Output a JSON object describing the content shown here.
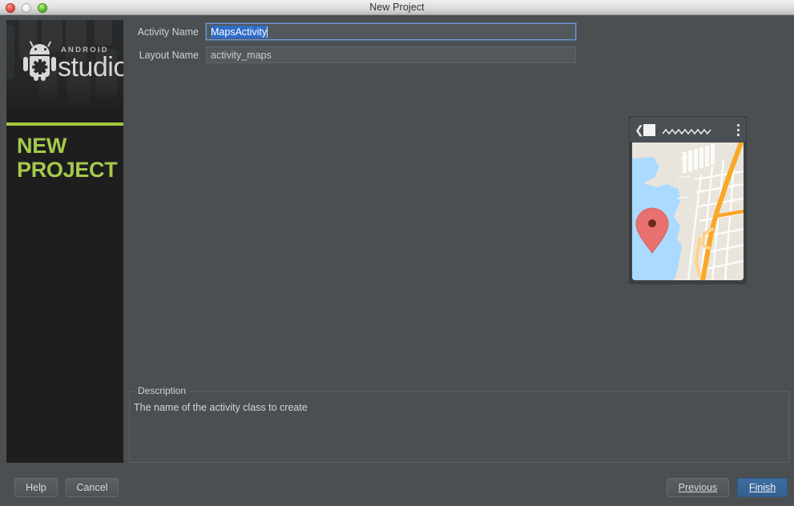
{
  "window": {
    "title": "New Project",
    "traffic_lights": [
      "close",
      "minimize",
      "zoom"
    ]
  },
  "sidebar": {
    "brand_small": "ANDROID",
    "brand_large": "studio",
    "wizard_title_line1": "NEW",
    "wizard_title_line2": "PROJECT",
    "accent_color": "#a4c639",
    "title_color": "#a5ca4c",
    "background_color": "#1e1e1e"
  },
  "form": {
    "fields": [
      {
        "label": "Activity Name",
        "value": "MapsActivity",
        "selected": true,
        "focused": true
      },
      {
        "label": "Layout Name",
        "value": "activity_maps",
        "selected": false,
        "focused": false
      }
    ]
  },
  "preview": {
    "name": "maps-activity-preview",
    "appbar": {
      "back_icon": "chevron-left-icon",
      "app_icon": "app-icon",
      "title_placeholder": "zigzag-placeholder",
      "overflow_icon": "overflow-menu-icon"
    },
    "map": {
      "marker": "map-marker-pin",
      "marker_color": "#e8706e",
      "water_color": "#aadaff",
      "land_color": "#e9e5dc",
      "road_color": "#f9a825",
      "street_color": "#ffffff"
    }
  },
  "description": {
    "legend": "Description",
    "text": "The name of the activity class to create"
  },
  "buttons": {
    "help": {
      "label": "Help",
      "mnemonic": ""
    },
    "cancel": {
      "label": "Cancel",
      "mnemonic": ""
    },
    "previous": {
      "label": "Previous",
      "mnemonic": "P"
    },
    "finish": {
      "label": "Finish",
      "mnemonic": "F",
      "primary": true
    }
  }
}
